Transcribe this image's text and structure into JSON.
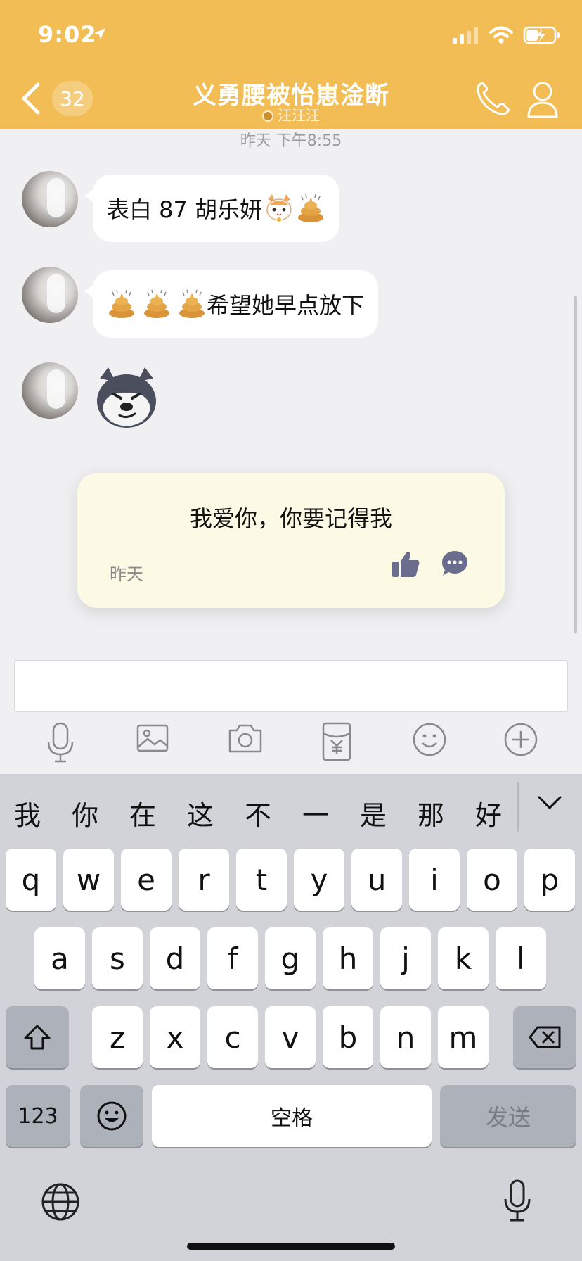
{
  "status_bar": {
    "time": "9:02"
  },
  "nav": {
    "back_count": "32",
    "title": "义勇腰被怡崽淦断",
    "subtitle": "汪汪汪"
  },
  "chat": {
    "timestamp": "昨天 下午8:55",
    "messages": [
      {
        "type": "text",
        "text": "表白 87 胡乐妍"
      },
      {
        "type": "text",
        "text": "希望她早点放下"
      },
      {
        "type": "sticker",
        "icon": "husky-sticker"
      }
    ],
    "featured_card": {
      "text": "我爱你，你要记得我",
      "date": "昨天"
    }
  },
  "input": {
    "placeholder": ""
  },
  "toolbar": [
    "microphone-icon",
    "image-icon",
    "camera-icon",
    "red-packet-icon",
    "emoji-icon",
    "plus-icon"
  ],
  "keyboard": {
    "candidates": [
      "我",
      "你",
      "在",
      "这",
      "不",
      "一",
      "是",
      "那",
      "好"
    ],
    "row1": [
      "q",
      "w",
      "e",
      "r",
      "t",
      "y",
      "u",
      "i",
      "o",
      "p"
    ],
    "row2": [
      "a",
      "s",
      "d",
      "f",
      "g",
      "h",
      "j",
      "k",
      "l"
    ],
    "row3": [
      "z",
      "x",
      "c",
      "v",
      "b",
      "n",
      "m"
    ],
    "num_key": "123",
    "space_key": "空格",
    "send_key": "发送"
  },
  "colors": {
    "header_bg": "#f2bd55",
    "card_bg": "#fcf9e4",
    "keyboard_bg": "#d1d3d9"
  }
}
